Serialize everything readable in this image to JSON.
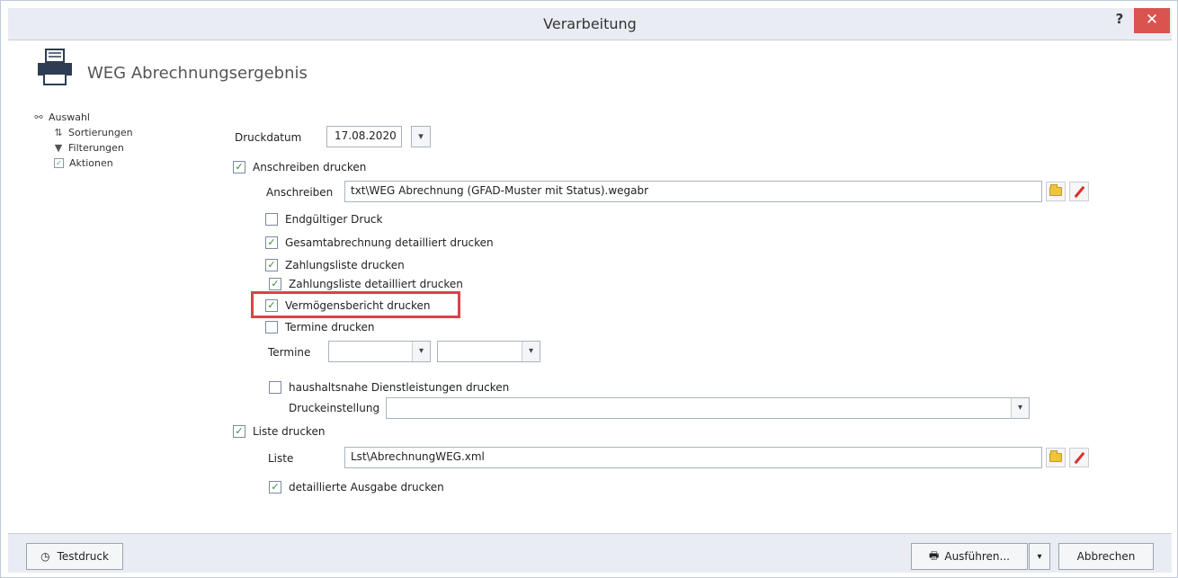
{
  "window": {
    "title": "Verarbeitung",
    "help_label": "?",
    "close_label": "✕"
  },
  "header": {
    "title": "WEG Abrechnungsergebnis",
    "icon": "printer-icon"
  },
  "tree": {
    "root": {
      "label": "Auswahl",
      "icon": "link-icon"
    },
    "items": [
      {
        "label": "Sortierungen",
        "icon": "sort-icon"
      },
      {
        "label": "Filterungen",
        "icon": "filter-icon"
      },
      {
        "label": "Aktionen",
        "icon": "checkbox-icon",
        "checked": true
      }
    ]
  },
  "form": {
    "druckdatum_label": "Druckdatum",
    "druckdatum_value": "17.08.2020",
    "anschreiben_drucken": {
      "label": "Anschreiben  drucken",
      "checked": true
    },
    "anschreiben_label": "Anschreiben",
    "anschreiben_value": "txt\\WEG Abrechnung (GFAD-Muster mit Status).wegabr",
    "options": [
      {
        "label": "Endgültiger Druck",
        "checked": false
      },
      {
        "label": "Gesamtabrechnung detailliert drucken",
        "checked": true
      },
      {
        "label": "Zahlungsliste drucken",
        "checked": true
      },
      {
        "label": "Zahlungsliste detailliert drucken",
        "checked": true
      },
      {
        "label": "Vermögensbericht drucken",
        "checked": true
      },
      {
        "label": "Termine drucken",
        "checked": false
      }
    ],
    "termine_label": "Termine",
    "termine_from": "",
    "termine_to": "",
    "haushaltsnahe": {
      "label": "haushaltsnahe Dienstleistungen drucken",
      "checked": false
    },
    "druckeinstellung_label": "Druckeinstellung",
    "druckeinstellung_value": "",
    "liste_drucken": {
      "label": "Liste drucken",
      "checked": true
    },
    "liste_label": "Liste",
    "liste_value": "Lst\\AbrechnungWEG.xml",
    "detaillierte_ausgabe": {
      "label": "detaillierte Ausgabe drucken",
      "checked": true
    }
  },
  "footer": {
    "testdruck_label": "Testdruck",
    "ausfuehren_label": "Ausführen...",
    "abbrechen_label": "Abbrechen"
  },
  "colors": {
    "highlight": "#d9434a",
    "close": "#d9534f",
    "check": "#2f8d3a"
  }
}
